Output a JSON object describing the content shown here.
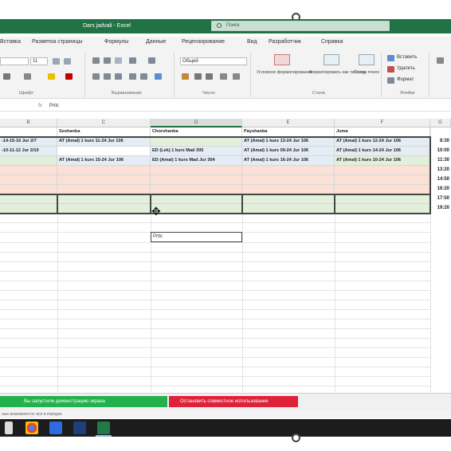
{
  "window": {
    "title": "Dars jadvali - Excel",
    "search_placeholder": "Поиск"
  },
  "ribbon_tabs": [
    "Вставка",
    "Разметка страницы",
    "Формулы",
    "Данные",
    "Рецензирование",
    "Вид",
    "Разработчик",
    "Справка"
  ],
  "ribbon": {
    "font_size": "11",
    "number_format": "Общий",
    "group_labels": [
      "Шрифт",
      "Выравнивание",
      "Число",
      "Стили",
      "Ячейки"
    ],
    "styles_buttons": [
      "Условное форматирование",
      "Форматировать как таблицу",
      "Стили ячеек"
    ],
    "cells_buttons": [
      "Вставить",
      "Удалить",
      "Формат"
    ]
  },
  "formula_bar": {
    "fx": "fx",
    "value": "Prtlc"
  },
  "columns": [
    {
      "id": "col-b",
      "label": "B"
    },
    {
      "id": "col-c",
      "label": "C"
    },
    {
      "id": "col-d",
      "label": "D"
    },
    {
      "id": "col-e",
      "label": "E"
    },
    {
      "id": "col-f",
      "label": "F"
    },
    {
      "id": "col-g",
      "label": "G"
    }
  ],
  "day_headers": [
    "Seshanba",
    "Chorshanba",
    "Payshanba",
    "Juma"
  ],
  "rows": [
    {
      "b": "-14-15-16 Jur 2/7",
      "c": "AT (Amal) 1 kurs 11-24 Jur 106",
      "d": "",
      "e": "AT (Amal) 1 kurs 13-24 Jur 106",
      "f": "AT (Amal) 1 kurs 12-24 Jur 106",
      "time": "8:30"
    },
    {
      "b": "-10-11-12 Jur 2/10",
      "c": "",
      "d": "ED (Lek) 1 kurs Mad 305",
      "e": "AT (Amal) 1 kurs 09-24 Jur 106",
      "f": "AT (Amal) 1 kurs 14-24 Jur 106",
      "time": "10:00"
    },
    {
      "b": "",
      "c": "AT (Amal) 1 kurs 15-24 Jur 106",
      "d": "ED (Amal) 1 kurs Mad Jur 304",
      "e": "AT (Amal) 1 kurs 16-24 Jur 106",
      "f": "AT (Amal) 1 kurs 10-24 Jur 106",
      "time": "11:30"
    },
    {
      "b": "",
      "c": "",
      "d": "",
      "e": "",
      "f": "",
      "time": "13:20"
    },
    {
      "b": "",
      "c": "",
      "d": "",
      "e": "",
      "f": "",
      "time": "14:50"
    },
    {
      "b": "",
      "c": "",
      "d": "",
      "e": "",
      "f": "",
      "time": "16:20"
    },
    {
      "b": "",
      "c": "",
      "d": "",
      "e": "",
      "f": "",
      "time": "17:50"
    },
    {
      "b": "",
      "c": "",
      "d": "",
      "e": "",
      "f": "",
      "time": "19:20"
    }
  ],
  "active_cell_value": "Prtlc",
  "notifications": {
    "screen_share": "Вы запустили демонстрацию экрана",
    "stop_sharing": "Остановить совместное использование"
  },
  "statusbar_text": "ные возможности: все в порядке"
}
